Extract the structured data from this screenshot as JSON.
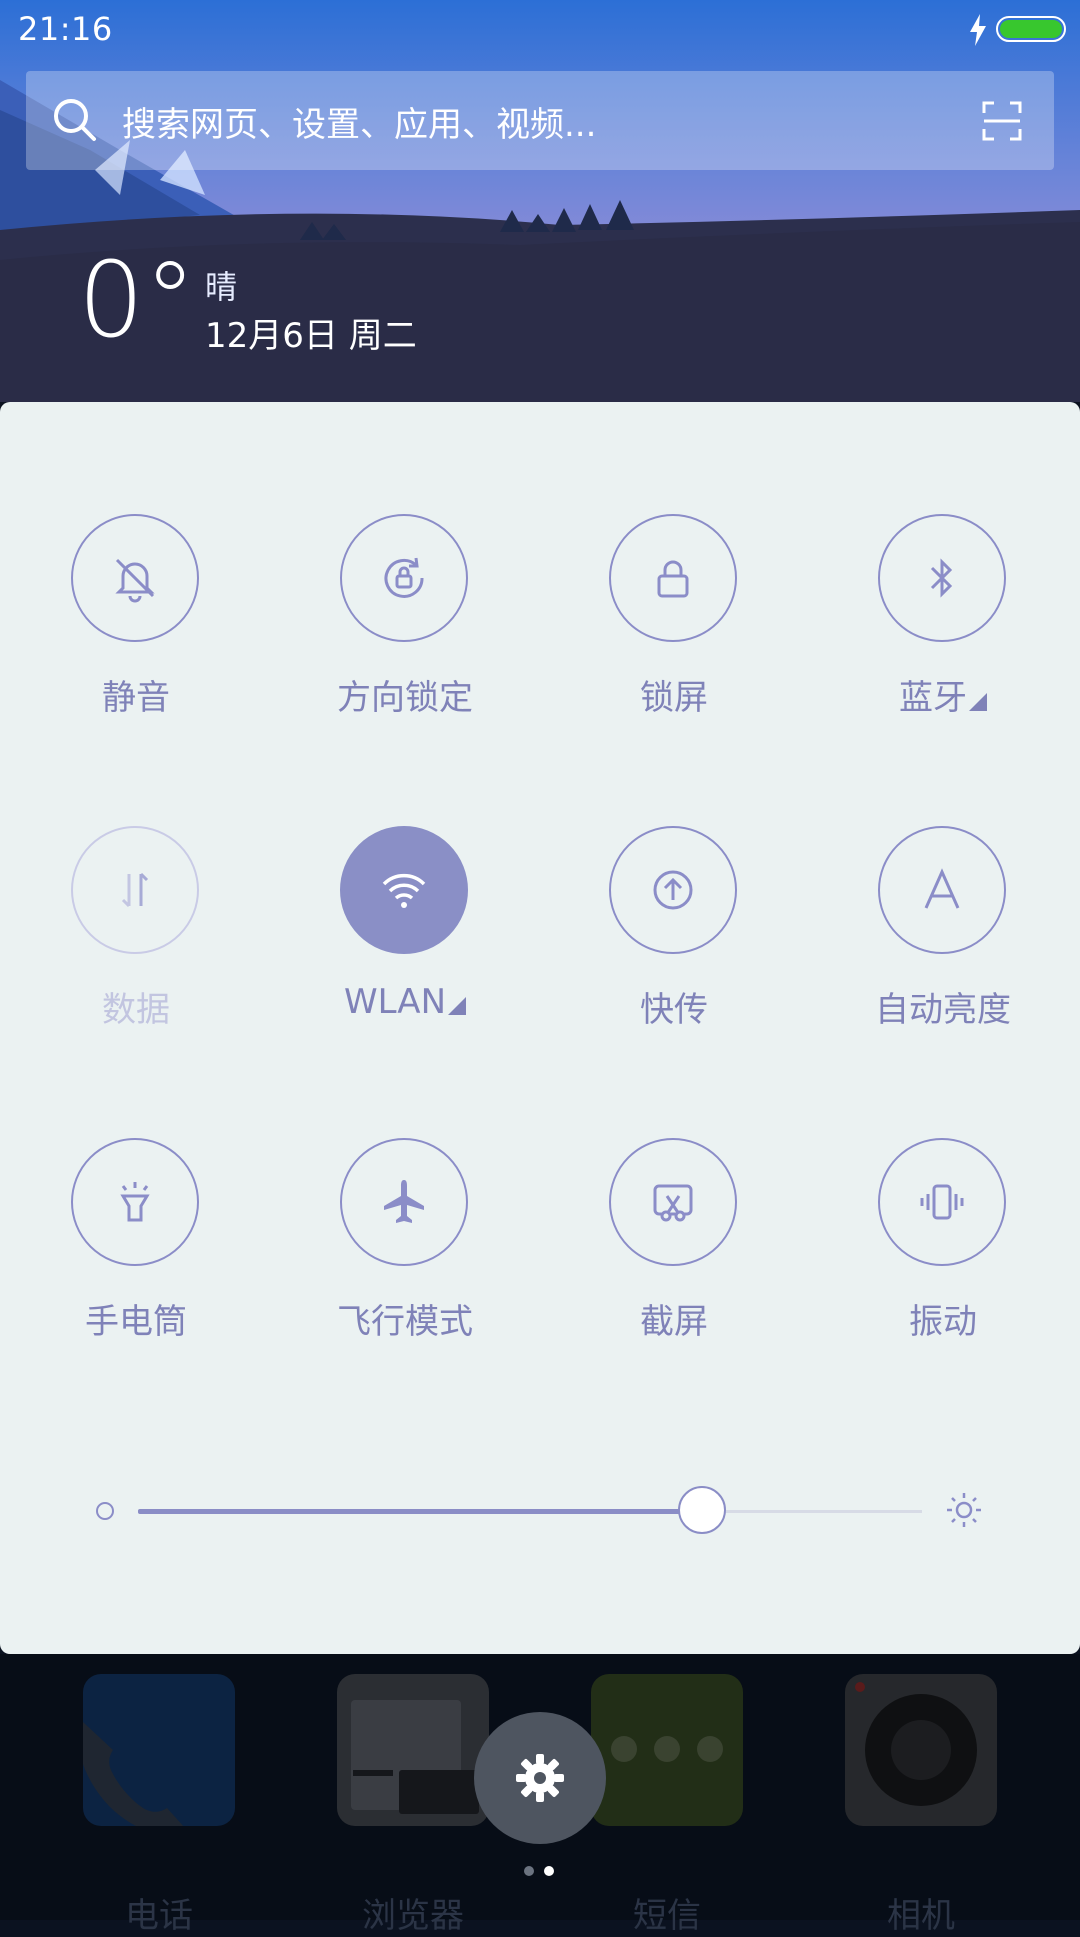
{
  "status_bar": {
    "time": "21:16"
  },
  "search": {
    "placeholder": "搜索网页、设置、应用、视频..."
  },
  "weather": {
    "temperature": "0°",
    "condition": "晴",
    "date": "12月6日 周二"
  },
  "quick_settings": {
    "tiles": [
      {
        "label": "静音",
        "icon": "bell-off-icon",
        "state": "off"
      },
      {
        "label": "方向锁定",
        "icon": "rotation-lock-icon",
        "state": "off"
      },
      {
        "label": "锁屏",
        "icon": "lock-icon",
        "state": "off"
      },
      {
        "label": "蓝牙",
        "icon": "bluetooth-icon",
        "state": "off",
        "has_menu": true
      },
      {
        "label": "数据",
        "icon": "data-transfer-icon",
        "state": "disabled"
      },
      {
        "label": "WLAN",
        "icon": "wifi-icon",
        "state": "on",
        "has_menu": true
      },
      {
        "label": "快传",
        "icon": "share-upload-icon",
        "state": "off"
      },
      {
        "label": "自动亮度",
        "icon": "auto-brightness-icon",
        "state": "off"
      },
      {
        "label": "手电筒",
        "icon": "flashlight-icon",
        "state": "off"
      },
      {
        "label": "飞行模式",
        "icon": "airplane-icon",
        "state": "off"
      },
      {
        "label": "截屏",
        "icon": "screenshot-icon",
        "state": "off"
      },
      {
        "label": "振动",
        "icon": "vibrate-icon",
        "state": "off"
      }
    ],
    "brightness": 0.72
  },
  "dock": {
    "apps": [
      {
        "label": "电话",
        "icon": "phone-icon"
      },
      {
        "label": "浏览器",
        "icon": "browser-icon"
      },
      {
        "label": "短信",
        "icon": "messages-icon"
      },
      {
        "label": "相机",
        "icon": "camera-icon"
      }
    ],
    "page_count": 2,
    "current_page": 2
  },
  "colors": {
    "accent": "#8a8fc6",
    "panel_bg": "#ebf2f2",
    "battery": "#38c72e"
  }
}
